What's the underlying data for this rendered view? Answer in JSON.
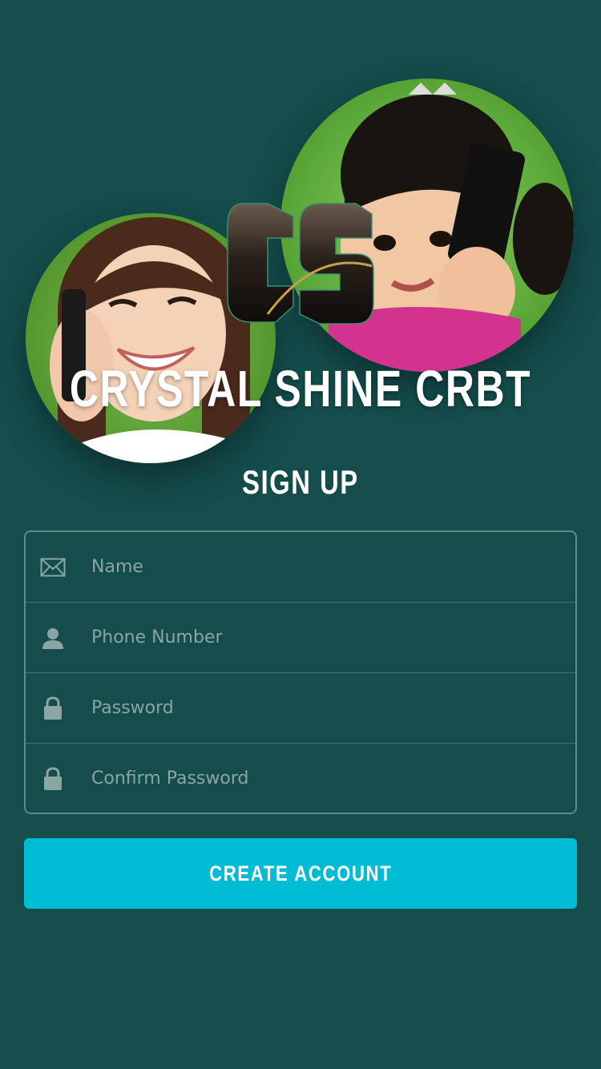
{
  "brand": {
    "title": "CRYSTAL SHINE CRBT"
  },
  "page": {
    "title": "SIGN UP"
  },
  "form": {
    "fields": [
      {
        "placeholder": "Name",
        "icon": "envelope-icon"
      },
      {
        "placeholder": "Phone Number",
        "icon": "person-icon"
      },
      {
        "placeholder": "Password",
        "icon": "lock-icon"
      },
      {
        "placeholder": "Confirm Password",
        "icon": "lock-icon"
      }
    ],
    "submit_label": "CREATE ACCOUNT"
  },
  "colors": {
    "background": "#144d4c",
    "button": "#01bcd5",
    "icon": "#8aa5a4"
  }
}
